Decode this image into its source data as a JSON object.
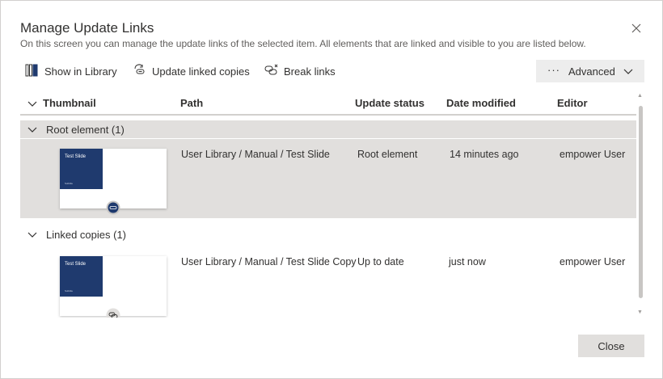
{
  "dialog": {
    "title": "Manage Update Links",
    "subtitle": "On this screen you can manage the update links of the selected item. All elements that are linked and visible to you are listed below.",
    "close_label": "Close"
  },
  "toolbar": {
    "show_in_library": "Show in Library",
    "update_linked_copies": "Update linked copies",
    "break_links": "Break links",
    "advanced_dots": "···",
    "advanced": "Advanced"
  },
  "table": {
    "headers": {
      "thumbnail": "Thumbnail",
      "path": "Path",
      "update_status": "Update status",
      "date_modified": "Date modified",
      "editor": "Editor"
    },
    "groups": [
      {
        "label": "Root element (1)",
        "rows": [
          {
            "thumb_title": "Test Slide",
            "thumb_sub": "Subtitle",
            "path": "User Library / Manual / Test Slide",
            "status": "Root element",
            "date": "14 minutes ago",
            "editor": "empower User"
          }
        ]
      },
      {
        "label": "Linked copies (1)",
        "rows": [
          {
            "thumb_title": "Test Slide",
            "thumb_sub": "Subtitle",
            "path": "User Library / Manual / Test Slide Copy",
            "status": "Up to date",
            "date": "just now",
            "editor": "empower User"
          }
        ]
      }
    ]
  },
  "colors": {
    "accent_navy": "#1f3a6e",
    "selected_row": "#e1dfdd",
    "button_bg": "#ededed"
  },
  "icons": {
    "close": "close-icon",
    "show_in_library": "library-books-icon",
    "update_linked_copies": "link-refresh-icon",
    "break_links": "link-break-icon",
    "chevron": "chevron-down-icon",
    "link_badge": "link-badge-icon"
  }
}
